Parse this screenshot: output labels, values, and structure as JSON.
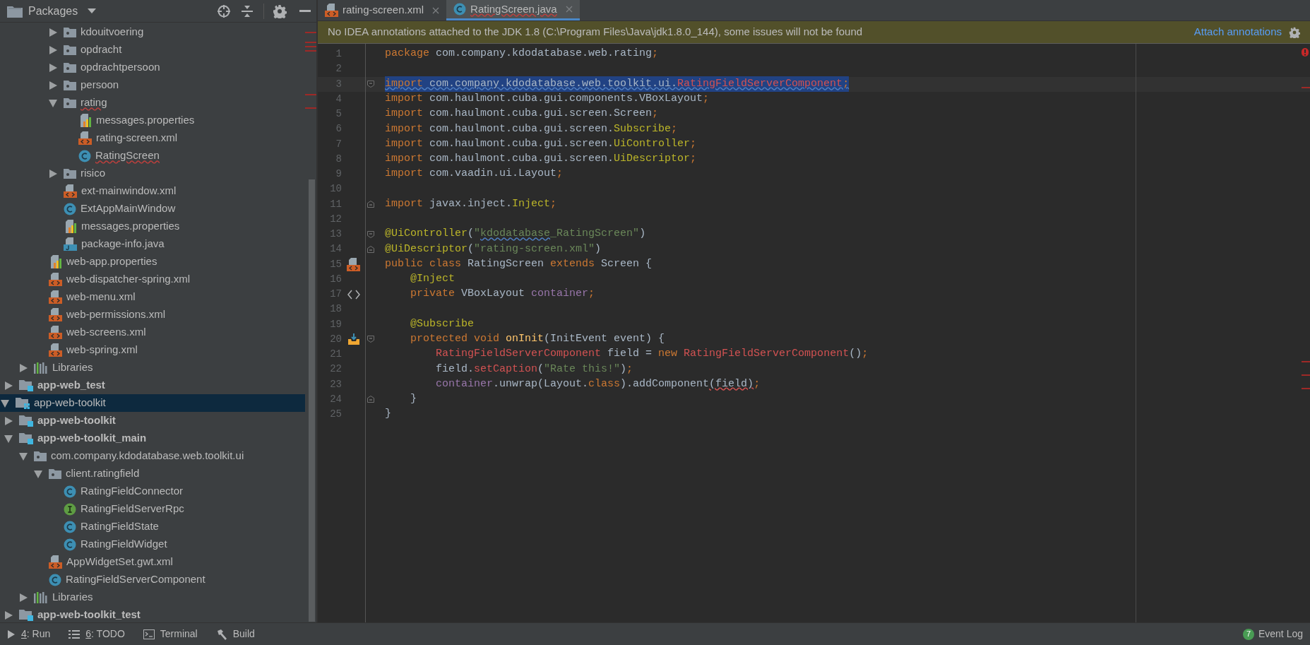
{
  "sidebar": {
    "title": "Packages"
  },
  "tree": {
    "items": [
      {
        "children": [
          {
            "children": [
              {
                "children": [
                  {
                    "children": [
                      {
                        "label": "kdouitvoering",
                        "kind": "package",
                        "expanded": false,
                        "selected": false,
                        "error": false
                      },
                      {
                        "label": "opdracht",
                        "kind": "package",
                        "expanded": false,
                        "selected": false,
                        "error": false
                      },
                      {
                        "label": "opdrachtpersoon",
                        "kind": "package",
                        "expanded": false,
                        "selected": false,
                        "error": false
                      },
                      {
                        "label": "persoon",
                        "kind": "package",
                        "expanded": false,
                        "selected": false,
                        "error": false
                      },
                      {
                        "label": "rating",
                        "kind": "package",
                        "expanded": true,
                        "selected": false,
                        "error": true,
                        "children": [
                          {
                            "label": "messages.properties",
                            "kind": "properties",
                            "selected": false,
                            "error": false
                          },
                          {
                            "label": "rating-screen.xml",
                            "kind": "xml",
                            "selected": false,
                            "error": false
                          },
                          {
                            "label": "RatingScreen",
                            "kind": "class",
                            "selected": false,
                            "error": true
                          }
                        ]
                      },
                      {
                        "label": "risico",
                        "kind": "package",
                        "expanded": false,
                        "selected": false,
                        "error": false
                      },
                      {
                        "label": "ext-mainwindow.xml",
                        "kind": "xml",
                        "selected": false,
                        "error": false
                      },
                      {
                        "label": "ExtAppMainWindow",
                        "kind": "class",
                        "selected": false,
                        "error": false
                      },
                      {
                        "label": "messages.properties",
                        "kind": "properties",
                        "selected": false,
                        "error": false
                      },
                      {
                        "label": "package-info.java",
                        "kind": "java",
                        "selected": false,
                        "error": false
                      }
                    ]
                  },
                  {
                    "label": "web-app.properties",
                    "kind": "properties",
                    "selected": false,
                    "error": false
                  },
                  {
                    "label": "web-dispatcher-spring.xml",
                    "kind": "xml",
                    "selected": false,
                    "error": false
                  },
                  {
                    "label": "web-menu.xml",
                    "kind": "xml",
                    "selected": false,
                    "error": false
                  },
                  {
                    "label": "web-permissions.xml",
                    "kind": "xml",
                    "selected": false,
                    "error": false
                  },
                  {
                    "label": "web-screens.xml",
                    "kind": "xml",
                    "selected": false,
                    "error": false
                  },
                  {
                    "label": "web-spring.xml",
                    "kind": "xml",
                    "selected": false,
                    "error": false
                  }
                ]
              },
              {
                "label": "Libraries",
                "kind": "libraries",
                "expanded": false,
                "selected": false,
                "error": false
              }
            ]
          },
          {
            "label": "app-web_test",
            "kind": "module",
            "expanded": false,
            "selected": false,
            "error": false
          }
        ]
      },
      {
        "label": "app-web-toolkit",
        "kind": "module-group",
        "expanded": true,
        "selected": true,
        "error": false,
        "children": [
          {
            "label": "app-web-toolkit",
            "kind": "module",
            "expanded": false,
            "selected": false,
            "error": false
          },
          {
            "label": "app-web-toolkit_main",
            "kind": "module",
            "expanded": true,
            "selected": false,
            "error": false,
            "children": [
              {
                "label": "com.company.kdodatabase.web.toolkit.ui",
                "kind": "package",
                "expanded": true,
                "selected": false,
                "error": false,
                "children": [
                  {
                    "label": "client.ratingfield",
                    "kind": "package",
                    "expanded": true,
                    "selected": false,
                    "error": false,
                    "children": [
                      {
                        "label": "RatingFieldConnector",
                        "kind": "class",
                        "selected": false,
                        "error": false
                      },
                      {
                        "label": "RatingFieldServerRpc",
                        "kind": "interface",
                        "selected": false,
                        "error": false
                      },
                      {
                        "label": "RatingFieldState",
                        "kind": "class",
                        "selected": false,
                        "error": false
                      },
                      {
                        "label": "RatingFieldWidget",
                        "kind": "class",
                        "selected": false,
                        "error": false
                      }
                    ]
                  },
                  {
                    "label": "AppWidgetSet.gwt.xml",
                    "kind": "xml",
                    "selected": false,
                    "error": false
                  },
                  {
                    "label": "RatingFieldServerComponent",
                    "kind": "class",
                    "selected": false,
                    "error": false
                  }
                ]
              },
              {
                "label": "Libraries",
                "kind": "libraries",
                "expanded": false,
                "selected": false,
                "error": false
              }
            ]
          },
          {
            "label": "app-web-toolkit_test",
            "kind": "module",
            "expanded": false,
            "selected": false,
            "error": false
          }
        ]
      }
    ]
  },
  "tabs": [
    {
      "label": "rating-screen.xml",
      "kind": "xml",
      "selected": false,
      "error": false
    },
    {
      "label": "RatingScreen.java",
      "kind": "class",
      "selected": true,
      "error": true
    }
  ],
  "banner": {
    "message": "No IDEA annotations attached to the JDK 1.8 (C:\\Program Files\\Java\\jdk1.8.0_144), some issues will not be found",
    "link": "Attach annotations"
  },
  "code": {
    "lines": [
      {
        "number": "1",
        "selected": false,
        "tokens": [
          {
            "t": "package ",
            "kind": "keyword"
          },
          {
            "t": "com.company.kdodatabase.web.rating",
            "kind": "plain"
          },
          {
            "t": ";",
            "kind": "keyword"
          }
        ]
      },
      {
        "number": "2",
        "selected": false
      },
      {
        "number": "3",
        "selected": true,
        "fold": {
          "kind": "start"
        },
        "tokens": [
          {
            "t": "import",
            "kind": "keyword",
            "typo": true
          },
          {
            "t": " com.company.kdodatabase.web.toolkit.ui.",
            "kind": "plain",
            "typo": true
          },
          {
            "t": "RatingFieldServerComponent",
            "kind": "unresolved",
            "typo": true
          },
          {
            "t": ";",
            "kind": "keyword",
            "typo": true
          }
        ]
      },
      {
        "number": "4",
        "selected": false,
        "tokens": [
          {
            "t": "import ",
            "kind": "keyword"
          },
          {
            "t": "com.haulmont.cuba.gui.components.VBoxLayout",
            "kind": "plain"
          },
          {
            "t": ";",
            "kind": "keyword"
          }
        ]
      },
      {
        "number": "5",
        "selected": false,
        "tokens": [
          {
            "t": "import ",
            "kind": "keyword"
          },
          {
            "t": "com.haulmont.cuba.gui.screen.Screen",
            "kind": "plain"
          },
          {
            "t": ";",
            "kind": "keyword"
          }
        ]
      },
      {
        "number": "6",
        "selected": false,
        "tokens": [
          {
            "t": "import ",
            "kind": "keyword"
          },
          {
            "t": "com.haulmont.cuba.gui.screen.",
            "kind": "plain"
          },
          {
            "t": "Subscribe",
            "kind": "annotation"
          },
          {
            "t": ";",
            "kind": "keyword"
          }
        ]
      },
      {
        "number": "7",
        "selected": false,
        "tokens": [
          {
            "t": "import ",
            "kind": "keyword"
          },
          {
            "t": "com.haulmont.cuba.gui.screen.",
            "kind": "plain"
          },
          {
            "t": "UiController",
            "kind": "annotation"
          },
          {
            "t": ";",
            "kind": "keyword"
          }
        ]
      },
      {
        "number": "8",
        "selected": false,
        "tokens": [
          {
            "t": "import ",
            "kind": "keyword"
          },
          {
            "t": "com.haulmont.cuba.gui.screen.",
            "kind": "plain"
          },
          {
            "t": "UiDescriptor",
            "kind": "annotation"
          },
          {
            "t": ";",
            "kind": "keyword"
          }
        ]
      },
      {
        "number": "9",
        "selected": false,
        "tokens": [
          {
            "t": "import ",
            "kind": "keyword"
          },
          {
            "t": "com.vaadin.ui.Layout",
            "kind": "plain"
          },
          {
            "t": ";",
            "kind": "keyword"
          }
        ]
      },
      {
        "number": "10",
        "selected": false
      },
      {
        "number": "11",
        "selected": false,
        "fold": {
          "kind": "end"
        },
        "tokens": [
          {
            "t": "import ",
            "kind": "keyword"
          },
          {
            "t": "javax.inject.",
            "kind": "plain"
          },
          {
            "t": "Inject",
            "kind": "annotation"
          },
          {
            "t": ";",
            "kind": "keyword"
          }
        ]
      },
      {
        "number": "12",
        "selected": false
      },
      {
        "number": "13",
        "selected": false,
        "fold": {
          "kind": "start"
        },
        "tokens": [
          {
            "t": "@UiController",
            "kind": "annotation"
          },
          {
            "t": "(",
            "kind": "plain"
          },
          {
            "t": "\"",
            "kind": "string"
          },
          {
            "t": "kdodatabase",
            "kind": "string",
            "typo": true
          },
          {
            "t": "_RatingScreen\"",
            "kind": "string"
          },
          {
            "t": ")",
            "kind": "plain"
          }
        ]
      },
      {
        "number": "14",
        "selected": false,
        "fold": {
          "kind": "end"
        },
        "tokens": [
          {
            "t": "@UiDescriptor",
            "kind": "annotation"
          },
          {
            "t": "(",
            "kind": "plain"
          },
          {
            "t": "\"rating-screen.xml\"",
            "kind": "string"
          },
          {
            "t": ")",
            "kind": "plain"
          }
        ]
      },
      {
        "number": "15",
        "selected": false,
        "gutter": {
          "kind": "xml"
        },
        "tokens": [
          {
            "t": "public class ",
            "kind": "keyword"
          },
          {
            "t": "RatingScreen ",
            "kind": "plain"
          },
          {
            "t": "extends ",
            "kind": "keyword"
          },
          {
            "t": "Screen {",
            "kind": "plain"
          }
        ]
      },
      {
        "number": "16",
        "selected": false,
        "tokens": [
          {
            "t": "    @Inject",
            "kind": "annotation"
          }
        ]
      },
      {
        "number": "17",
        "selected": false,
        "gutter": {
          "kind": "code"
        },
        "tokens": [
          {
            "t": "    private ",
            "kind": "keyword"
          },
          {
            "t": "VBoxLayout ",
            "kind": "plain"
          },
          {
            "t": "container",
            "kind": "field"
          },
          {
            "t": ";",
            "kind": "keyword"
          }
        ]
      },
      {
        "number": "18",
        "selected": false
      },
      {
        "number": "19",
        "selected": false,
        "tokens": [
          {
            "t": "    @Subscribe",
            "kind": "annotation"
          }
        ]
      },
      {
        "number": "20",
        "selected": false,
        "gutter": {
          "kind": "subscribe"
        },
        "fold": {
          "kind": "start"
        },
        "tokens": [
          {
            "t": "    protected void ",
            "kind": "keyword"
          },
          {
            "t": "onInit",
            "kind": "method"
          },
          {
            "t": "(InitEvent event) {",
            "kind": "plain"
          }
        ]
      },
      {
        "number": "21",
        "selected": false,
        "tokens": [
          {
            "t": "        RatingFieldServerComponent",
            "kind": "unresolved"
          },
          {
            "t": " field = ",
            "kind": "plain"
          },
          {
            "t": "new ",
            "kind": "keyword"
          },
          {
            "t": "RatingFieldServerComponent",
            "kind": "unresolved"
          },
          {
            "t": "()",
            "kind": "plain"
          },
          {
            "t": ";",
            "kind": "keyword"
          }
        ]
      },
      {
        "number": "22",
        "selected": false,
        "tokens": [
          {
            "t": "        field.",
            "kind": "plain"
          },
          {
            "t": "setCaption",
            "kind": "unresolved"
          },
          {
            "t": "(",
            "kind": "plain"
          },
          {
            "t": "\"Rate this!\"",
            "kind": "string"
          },
          {
            "t": ")",
            "kind": "plain"
          },
          {
            "t": ";",
            "kind": "keyword"
          }
        ]
      },
      {
        "number": "23",
        "selected": false,
        "tokens": [
          {
            "t": "        container",
            "kind": "field"
          },
          {
            "t": ".unwrap(Layout.",
            "kind": "plain"
          },
          {
            "t": "class",
            "kind": "keyword"
          },
          {
            "t": ").addComponent",
            "kind": "plain"
          },
          {
            "t": "(field)",
            "kind": "plain",
            "error": true
          },
          {
            "t": ";",
            "kind": "keyword"
          }
        ]
      },
      {
        "number": "24",
        "selected": false,
        "fold": {
          "kind": "end"
        },
        "tokens": [
          {
            "t": "    }",
            "kind": "plain"
          }
        ]
      },
      {
        "number": "25",
        "selected": false,
        "tokens": [
          {
            "t": "}",
            "kind": "plain"
          }
        ]
      }
    ]
  },
  "bottom_bar": {
    "tools": [
      {
        "key": "4",
        "label": ": Run",
        "kind": "run"
      },
      {
        "key": "6",
        "label": ": TODO",
        "kind": "todo"
      },
      {
        "label": "Terminal",
        "kind": "terminal"
      },
      {
        "label": "Build",
        "kind": "build"
      }
    ],
    "event_log": {
      "count": "7",
      "label": "Event Log"
    }
  }
}
